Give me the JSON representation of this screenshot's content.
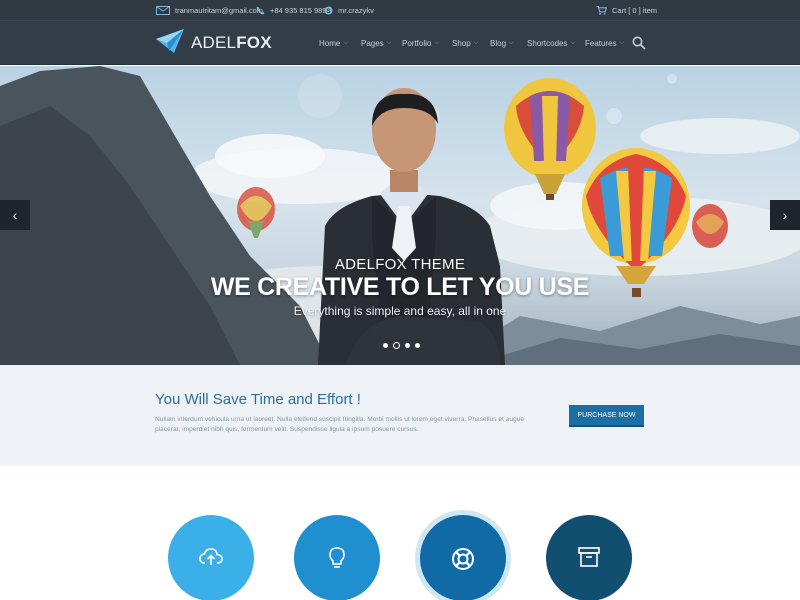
{
  "topbar": {
    "email": "tranmautritam@gmail.com",
    "phone": "+84 935 815 989",
    "skype": "mr.crazykv",
    "cart": "Cart [ 0 ] item",
    "icons": [
      "mail-icon",
      "phone-icon",
      "skype-icon",
      "cart-icon"
    ]
  },
  "header": {
    "logo_part1": "ADEL",
    "logo_part2": "FOX",
    "nav": [
      "Home",
      "Pages",
      "Portfolio",
      "Shop",
      "Blog",
      "Shortcodes",
      "Features"
    ],
    "search_icon": "search-icon"
  },
  "hero": {
    "caption_small": "ADELFOX THEME",
    "caption_big": "WE CREATIVE TO LET YOU USE",
    "caption_sub": "Everything is simple and easy, all in one",
    "slide_count": 4,
    "active_slide": 2
  },
  "callout": {
    "title": "You Will Save Time and Effort !",
    "text": "Nullam interdum vehicula urna ut laoreet. Nulla eleifend suscipit fringilla. Morbi mollis ut lorem eget viverra. Phasellus et augue placerat, imperdiet nibh quis, fermentum velit. Suspendisse ligula a ipsum posuere cursus.",
    "button": "PURCHASE NOW"
  },
  "features": {
    "icons": [
      "cloud-upload-icon",
      "lightbulb-icon",
      "lifebuoy-icon",
      "archive-icon"
    ]
  },
  "colors": {
    "topbar_bg": "#2f3a43",
    "header_bg": "#323d47",
    "accent": "#1b6fa5",
    "callout_bg": "#eef2f6",
    "feature_1": "#3aafe8",
    "feature_2": "#1f8fd0",
    "feature_3": "#0f6aa6",
    "feature_4": "#124e70"
  }
}
